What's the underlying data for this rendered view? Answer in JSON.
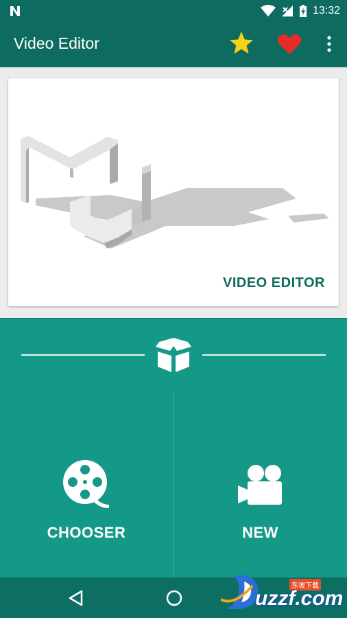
{
  "status_bar": {
    "time": "13:32"
  },
  "app_bar": {
    "title": "Video Editor",
    "star_color": "#f5d01c",
    "heart_color": "#e82a2a"
  },
  "banner": {
    "caption": "VIDEO EDITOR"
  },
  "tiles": [
    {
      "label": "CHOOSER",
      "icon": "film-reel-icon"
    },
    {
      "label": "NEW",
      "icon": "video-camera-icon"
    }
  ],
  "watermark": {
    "text": "uzzf.com",
    "badge": "东坡下载"
  },
  "colors": {
    "primary_dark": "#0e6b5f",
    "primary": "#149887",
    "nav": "#0d6f62"
  }
}
